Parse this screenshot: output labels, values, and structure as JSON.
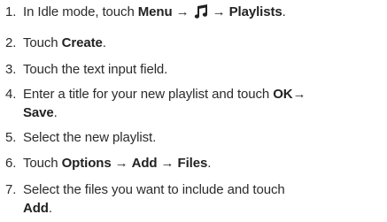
{
  "steps": [
    {
      "num": "1.",
      "parts": [
        {
          "t": "In Idle mode, touch ",
          "b": false
        },
        {
          "t": "Menu",
          "b": true
        },
        {
          "t": " → ",
          "b": false
        },
        {
          "icon": "music-note-icon"
        },
        {
          "t": " → ",
          "b": false
        },
        {
          "t": "Playlists",
          "b": true
        },
        {
          "t": ".",
          "b": false
        }
      ]
    },
    {
      "num": "2.",
      "parts": [
        {
          "t": "Touch ",
          "b": false
        },
        {
          "t": "Create",
          "b": true
        },
        {
          "t": ".",
          "b": false
        }
      ]
    },
    {
      "num": "3.",
      "parts": [
        {
          "t": "Touch the text input field.",
          "b": false
        }
      ]
    },
    {
      "num": "4.",
      "parts": [
        {
          "t": "Enter a title for your new playlist and touch ",
          "b": false
        },
        {
          "t": "OK",
          "b": true
        },
        {
          "t": "→",
          "b": false
        },
        {
          "br": true
        },
        {
          "t": "Save",
          "b": true
        },
        {
          "t": ".",
          "b": false
        }
      ]
    },
    {
      "num": "5.",
      "parts": [
        {
          "t": "Select the new playlist.",
          "b": false
        }
      ]
    },
    {
      "num": "6.",
      "parts": [
        {
          "t": "Touch ",
          "b": false
        },
        {
          "t": "Options",
          "b": true
        },
        {
          "t": " → ",
          "b": false
        },
        {
          "t": "Add",
          "b": true
        },
        {
          "t": " → ",
          "b": false
        },
        {
          "t": "Files",
          "b": true
        },
        {
          "t": ".",
          "b": false
        }
      ]
    },
    {
      "num": "7.",
      "parts": [
        {
          "t": "Select the files you want to include and touch",
          "b": false
        },
        {
          "br": true
        },
        {
          "t": "Add",
          "b": true
        },
        {
          "t": ".",
          "b": false
        }
      ]
    }
  ]
}
